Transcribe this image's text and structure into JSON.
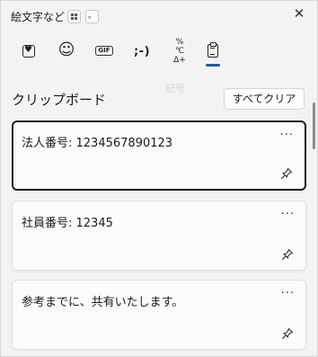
{
  "titlebar": {
    "title": "絵文字など",
    "chip_dot": "。",
    "close_symbol": "✕"
  },
  "tabs": [
    {
      "name": "favorites-tab",
      "icon": "heart-icon"
    },
    {
      "name": "emoji-tab",
      "icon": "smiley-icon",
      "glyph": "☺"
    },
    {
      "name": "gif-tab",
      "icon": "gif-icon",
      "glyph": "GIF"
    },
    {
      "name": "kaomoji-tab",
      "icon": "kaomoji-icon",
      "glyph": ";-)"
    },
    {
      "name": "symbols-tab",
      "icon": "symbols-icon",
      "glyph_top": "%℃",
      "glyph_bottom": "Δ+"
    },
    {
      "name": "clipboard-tab",
      "icon": "clipboard-icon",
      "active": true
    }
  ],
  "faint_label": "記号",
  "section": {
    "title": "クリップボード",
    "clear_all": "すべてクリア"
  },
  "clipboard_items": [
    {
      "text": "法人番号: 1234567890123",
      "selected": true
    },
    {
      "text": "社員番号: 12345",
      "selected": false
    },
    {
      "text": "参考までに、共有いたします。",
      "selected": false
    }
  ],
  "more_symbol": "···",
  "colors": {
    "accent": "#005fb8",
    "background": "#f3f3f3",
    "card": "#fbfbfb"
  }
}
